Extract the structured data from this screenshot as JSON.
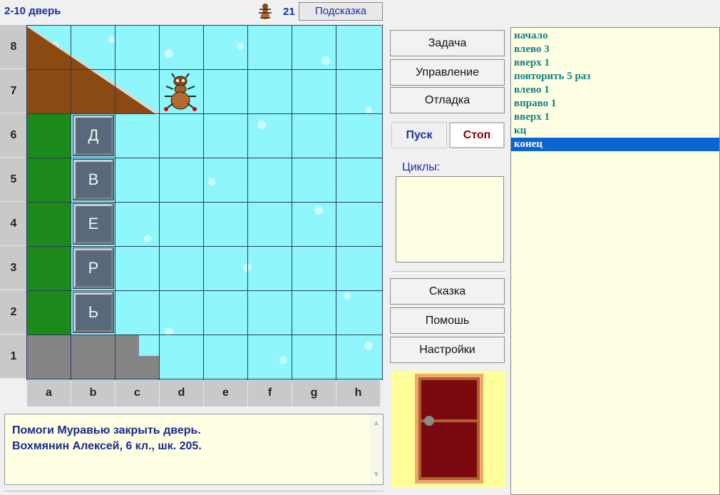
{
  "header": {
    "title": "2-10 дверь",
    "step_count": "21",
    "hint_label": "Подсказка"
  },
  "board": {
    "rows": [
      "8",
      "7",
      "6",
      "5",
      "4",
      "3",
      "2",
      "1"
    ],
    "cols": [
      "a",
      "b",
      "c",
      "d",
      "e",
      "f",
      "g",
      "h"
    ],
    "letters": [
      "Д",
      "В",
      "Е",
      "Р",
      "Ь"
    ],
    "colors": {
      "ice": "#8ff7fb",
      "grid": "#2a3a6a",
      "green": "#1b8a1b",
      "brown": "#8a4a12",
      "gray": "#858585"
    }
  },
  "message": {
    "line1": "Помоги Муравью закрыть дверь.",
    "line2": "Вохмянин Алексей, 6 кл., шк. 205."
  },
  "panel": {
    "task": "Задача",
    "control": "Управление",
    "debug": "Отладка",
    "run": "Пуск",
    "stop": "Стоп",
    "loops_label": "Циклы:",
    "tale": "Сказка",
    "help": "Помошь",
    "settings": "Настройки"
  },
  "program": {
    "lines": [
      "начало",
      "влево 3",
      "вверх 1",
      "повторить 5 раз",
      "влево 1",
      "вправо 1",
      "вверх 1",
      "кц",
      "конец"
    ],
    "selected_index": 8
  }
}
